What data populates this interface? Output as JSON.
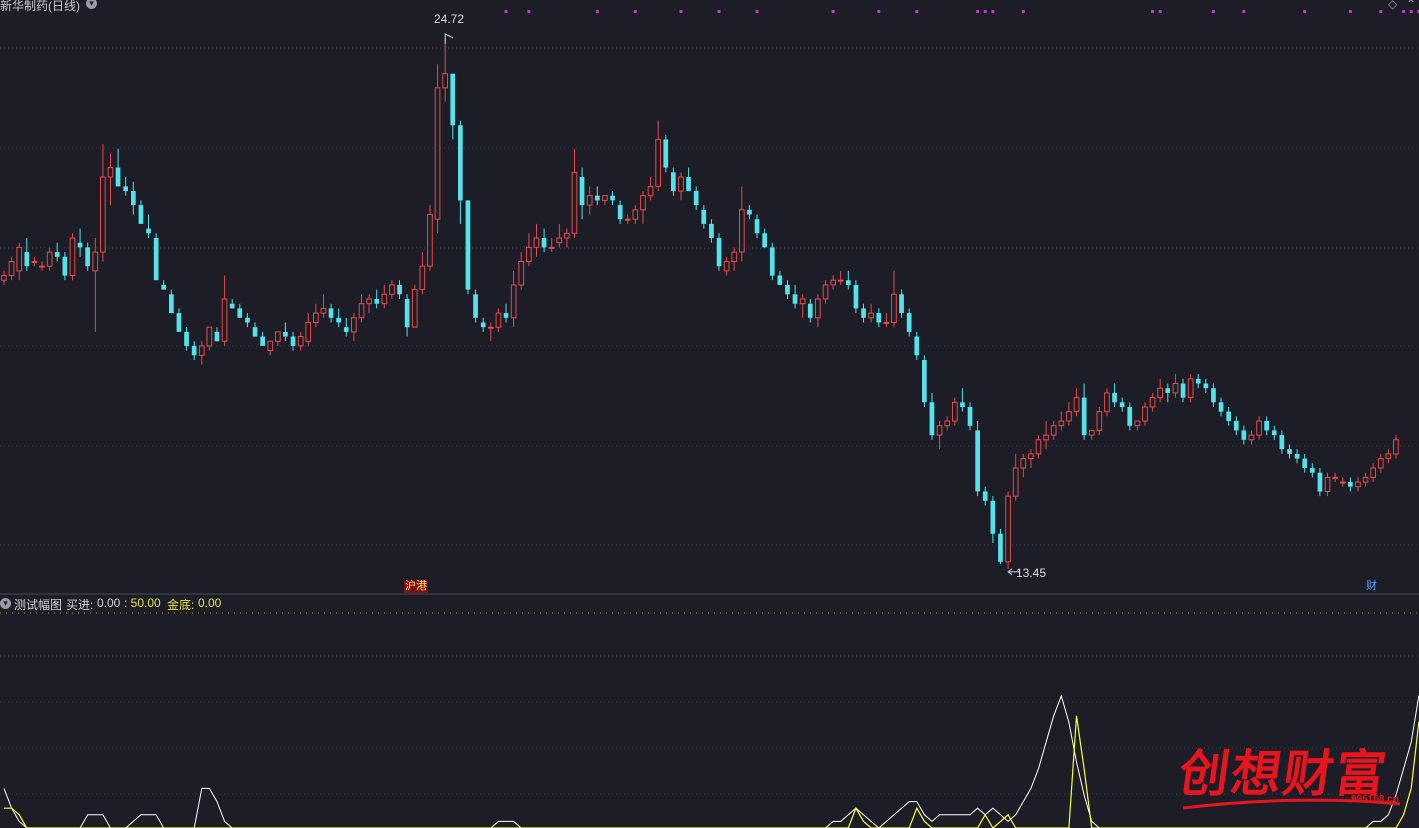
{
  "main_panel": {
    "title": "新华制药(日线)",
    "high_label": "24.72",
    "low_label": "13.45",
    "marker_hk": "沪港",
    "marker_cai": "财"
  },
  "indicator_panel": {
    "name": "测试幅图",
    "buy_label": "买进:",
    "buy_value": "0.00",
    "level_value": ": 50.00",
    "gold_label": "金底:",
    "gold_value": "0.00"
  },
  "watermark": {
    "text": "创想财富",
    "url": "995168.cn"
  },
  "colors": {
    "background": "#1c1d26",
    "up": "#e84a4a",
    "down": "#54e3ec",
    "grid": "#3b3d4c",
    "signal": "#cc33cc",
    "indicator_line": "#ffffff",
    "indicator_yellow": "#ffff33",
    "watermark": "#e8141e"
  },
  "chart_data": {
    "type": "candlestick",
    "y_range": [
      13.0,
      25.4
    ],
    "price_high": 24.72,
    "price_low": 13.45,
    "candles": [
      [
        19.6,
        19.8,
        19.5,
        19.7
      ],
      [
        19.7,
        20.1,
        19.6,
        20.0
      ],
      [
        19.8,
        20.4,
        19.6,
        20.3
      ],
      [
        20.2,
        20.5,
        19.8,
        19.9
      ],
      [
        20.0,
        20.1,
        19.9,
        20.0
      ],
      [
        19.9,
        20.0,
        19.8,
        19.9
      ],
      [
        19.9,
        20.3,
        19.8,
        20.2
      ],
      [
        20.2,
        20.4,
        20.0,
        20.1
      ],
      [
        20.1,
        20.2,
        19.6,
        19.7
      ],
      [
        19.7,
        20.6,
        19.6,
        20.5
      ],
      [
        20.4,
        20.7,
        20.1,
        20.3
      ],
      [
        20.3,
        20.4,
        19.8,
        19.9
      ],
      [
        19.8,
        20.5,
        18.5,
        20.2
      ],
      [
        20.2,
        22.5,
        20.0,
        21.8
      ],
      [
        21.8,
        22.3,
        21.2,
        22.0
      ],
      [
        22.0,
        22.4,
        21.6,
        21.6
      ],
      [
        21.6,
        21.8,
        21.4,
        21.5
      ],
      [
        21.5,
        21.7,
        21.0,
        21.2
      ],
      [
        21.2,
        21.3,
        20.8,
        20.8
      ],
      [
        20.7,
        21.0,
        20.5,
        20.6
      ],
      [
        20.5,
        20.6,
        19.6,
        19.6
      ],
      [
        19.5,
        19.6,
        19.4,
        19.4
      ],
      [
        19.3,
        19.4,
        18.9,
        18.9
      ],
      [
        18.9,
        19.0,
        18.5,
        18.5
      ],
      [
        18.5,
        18.6,
        18.1,
        18.2
      ],
      [
        18.2,
        18.3,
        17.9,
        18.0
      ],
      [
        18.0,
        18.3,
        17.8,
        18.2
      ],
      [
        18.2,
        18.6,
        18.1,
        18.6
      ],
      [
        18.5,
        18.6,
        18.3,
        18.3
      ],
      [
        18.3,
        19.7,
        18.2,
        19.2
      ],
      [
        19.1,
        19.2,
        19.0,
        19.0
      ],
      [
        19.0,
        19.1,
        18.8,
        18.8
      ],
      [
        18.8,
        18.9,
        18.6,
        18.7
      ],
      [
        18.6,
        18.7,
        18.4,
        18.4
      ],
      [
        18.4,
        18.5,
        18.2,
        18.2
      ],
      [
        18.1,
        18.3,
        18.0,
        18.3
      ],
      [
        18.3,
        18.5,
        18.2,
        18.5
      ],
      [
        18.5,
        18.7,
        18.3,
        18.4
      ],
      [
        18.4,
        18.5,
        18.1,
        18.2
      ],
      [
        18.2,
        18.5,
        18.1,
        18.4
      ],
      [
        18.3,
        18.9,
        18.2,
        18.7
      ],
      [
        18.7,
        19.1,
        18.6,
        18.9
      ],
      [
        18.9,
        19.3,
        18.8,
        19.0
      ],
      [
        19.0,
        19.1,
        18.7,
        18.8
      ],
      [
        18.8,
        19.0,
        18.6,
        18.7
      ],
      [
        18.6,
        18.8,
        18.4,
        18.5
      ],
      [
        18.5,
        18.9,
        18.3,
        18.8
      ],
      [
        18.8,
        19.3,
        18.7,
        19.1
      ],
      [
        19.1,
        19.3,
        18.9,
        19.2
      ],
      [
        19.2,
        19.4,
        19.0,
        19.1
      ],
      [
        19.1,
        19.5,
        19.0,
        19.3
      ],
      [
        19.3,
        19.6,
        19.2,
        19.5
      ],
      [
        19.5,
        19.6,
        19.2,
        19.3
      ],
      [
        19.2,
        19.3,
        18.4,
        18.6
      ],
      [
        18.6,
        19.5,
        18.6,
        19.4
      ],
      [
        19.4,
        20.2,
        19.3,
        19.9
      ],
      [
        19.9,
        21.2,
        19.8,
        21.0
      ],
      [
        20.9,
        24.2,
        20.6,
        23.7
      ],
      [
        23.7,
        24.72,
        23.4,
        24.0
      ],
      [
        24.0,
        24.0,
        22.6,
        22.9
      ],
      [
        22.9,
        23.0,
        20.8,
        21.3
      ],
      [
        21.3,
        21.3,
        19.3,
        19.4
      ],
      [
        19.3,
        19.4,
        18.7,
        18.8
      ],
      [
        18.7,
        18.8,
        18.5,
        18.6
      ],
      [
        18.6,
        18.7,
        18.3,
        18.6
      ],
      [
        18.6,
        19.0,
        18.5,
        18.9
      ],
      [
        18.9,
        19.1,
        18.7,
        18.8
      ],
      [
        18.8,
        19.8,
        18.6,
        19.5
      ],
      [
        19.5,
        20.2,
        19.4,
        20.0
      ],
      [
        20.0,
        20.6,
        19.9,
        20.3
      ],
      [
        20.3,
        20.8,
        20.1,
        20.5
      ],
      [
        20.5,
        20.7,
        20.2,
        20.3
      ],
      [
        20.3,
        20.5,
        20.2,
        20.3
      ],
      [
        20.4,
        20.8,
        20.3,
        20.5
      ],
      [
        20.5,
        20.7,
        20.3,
        20.6
      ],
      [
        20.6,
        22.4,
        20.5,
        21.9
      ],
      [
        21.8,
        22.0,
        20.9,
        21.2
      ],
      [
        21.2,
        21.6,
        21.0,
        21.4
      ],
      [
        21.4,
        21.6,
        21.2,
        21.3
      ],
      [
        21.3,
        21.4,
        21.2,
        21.4
      ],
      [
        21.4,
        21.5,
        21.2,
        21.3
      ],
      [
        21.2,
        21.3,
        20.8,
        20.9
      ],
      [
        20.9,
        21.0,
        20.8,
        20.9
      ],
      [
        20.9,
        21.2,
        20.8,
        21.1
      ],
      [
        21.1,
        21.5,
        20.8,
        21.4
      ],
      [
        21.4,
        21.8,
        21.3,
        21.6
      ],
      [
        21.6,
        23.0,
        21.5,
        22.6
      ],
      [
        22.6,
        22.7,
        21.9,
        22.0
      ],
      [
        21.9,
        22.0,
        21.4,
        21.5
      ],
      [
        21.5,
        21.9,
        21.3,
        21.8
      ],
      [
        21.8,
        22.0,
        21.5,
        21.5
      ],
      [
        21.5,
        21.6,
        21.1,
        21.2
      ],
      [
        21.1,
        21.2,
        20.7,
        20.8
      ],
      [
        20.8,
        20.9,
        20.4,
        20.5
      ],
      [
        20.5,
        20.6,
        19.8,
        19.9
      ],
      [
        19.8,
        20.1,
        19.7,
        20.0
      ],
      [
        20.0,
        20.3,
        19.8,
        20.2
      ],
      [
        20.2,
        21.6,
        20.0,
        21.1
      ],
      [
        21.1,
        21.2,
        20.9,
        21.0
      ],
      [
        20.9,
        21.0,
        20.5,
        20.6
      ],
      [
        20.6,
        20.7,
        20.3,
        20.3
      ],
      [
        20.3,
        20.4,
        19.6,
        19.7
      ],
      [
        19.7,
        19.8,
        19.5,
        19.5
      ],
      [
        19.5,
        19.6,
        19.2,
        19.3
      ],
      [
        19.3,
        19.5,
        19.0,
        19.1
      ],
      [
        19.1,
        19.3,
        18.8,
        19.2
      ],
      [
        19.1,
        19.2,
        18.7,
        18.8
      ],
      [
        18.8,
        19.3,
        18.6,
        19.2
      ],
      [
        19.2,
        19.6,
        19.1,
        19.5
      ],
      [
        19.5,
        19.7,
        19.4,
        19.6
      ],
      [
        19.6,
        19.8,
        19.5,
        19.6
      ],
      [
        19.6,
        19.8,
        19.4,
        19.5
      ],
      [
        19.5,
        19.6,
        18.9,
        19.0
      ],
      [
        19.0,
        19.1,
        18.7,
        18.8
      ],
      [
        18.8,
        19.1,
        18.7,
        18.9
      ],
      [
        18.9,
        19.0,
        18.6,
        18.7
      ],
      [
        18.7,
        18.9,
        18.6,
        18.7
      ],
      [
        18.7,
        19.8,
        18.6,
        19.3
      ],
      [
        19.3,
        19.4,
        18.8,
        18.9
      ],
      [
        18.9,
        19.0,
        18.4,
        18.5
      ],
      [
        18.4,
        18.5,
        17.9,
        18.0
      ],
      [
        17.9,
        18.0,
        16.9,
        17.0
      ],
      [
        17.0,
        17.2,
        16.2,
        16.3
      ],
      [
        16.3,
        16.6,
        16.0,
        16.5
      ],
      [
        16.5,
        16.7,
        16.4,
        16.6
      ],
      [
        16.6,
        17.1,
        16.5,
        17.0
      ],
      [
        17.0,
        17.3,
        16.8,
        16.9
      ],
      [
        16.9,
        17.0,
        16.4,
        16.5
      ],
      [
        16.4,
        16.6,
        15.0,
        15.1
      ],
      [
        15.1,
        15.2,
        14.8,
        14.9
      ],
      [
        14.9,
        15.0,
        14.0,
        14.2
      ],
      [
        14.2,
        14.3,
        13.55,
        13.6
      ],
      [
        13.6,
        15.1,
        13.45,
        15.0
      ],
      [
        15.0,
        15.9,
        14.9,
        15.6
      ],
      [
        15.6,
        15.9,
        15.4,
        15.8
      ],
      [
        15.8,
        16.0,
        15.6,
        15.9
      ],
      [
        15.9,
        16.3,
        15.8,
        16.2
      ],
      [
        16.2,
        16.6,
        16.0,
        16.3
      ],
      [
        16.3,
        16.6,
        16.2,
        16.5
      ],
      [
        16.5,
        16.8,
        16.4,
        16.6
      ],
      [
        16.6,
        17.0,
        16.5,
        16.8
      ],
      [
        16.8,
        17.3,
        16.7,
        17.1
      ],
      [
        17.1,
        17.4,
        16.2,
        16.3
      ],
      [
        16.3,
        16.4,
        16.2,
        16.4
      ],
      [
        16.4,
        16.9,
        16.3,
        16.8
      ],
      [
        16.8,
        17.3,
        16.7,
        17.2
      ],
      [
        17.2,
        17.4,
        16.9,
        17.0
      ],
      [
        17.0,
        17.1,
        16.8,
        16.9
      ],
      [
        16.9,
        17.0,
        16.4,
        16.5
      ],
      [
        16.5,
        16.6,
        16.4,
        16.6
      ],
      [
        16.6,
        17.0,
        16.5,
        16.9
      ],
      [
        16.9,
        17.2,
        16.8,
        17.1
      ],
      [
        17.1,
        17.5,
        17.0,
        17.3
      ],
      [
        17.3,
        17.4,
        17.0,
        17.2
      ],
      [
        17.2,
        17.6,
        17.1,
        17.4
      ],
      [
        17.4,
        17.5,
        17.0,
        17.1
      ],
      [
        17.1,
        17.6,
        17.0,
        17.5
      ],
      [
        17.5,
        17.6,
        17.3,
        17.4
      ],
      [
        17.4,
        17.5,
        17.2,
        17.3
      ],
      [
        17.3,
        17.4,
        16.9,
        17.0
      ],
      [
        17.0,
        17.1,
        16.7,
        16.8
      ],
      [
        16.8,
        16.9,
        16.5,
        16.6
      ],
      [
        16.6,
        16.7,
        16.3,
        16.4
      ],
      [
        16.4,
        16.5,
        16.1,
        16.2
      ],
      [
        16.2,
        16.4,
        16.1,
        16.3
      ],
      [
        16.3,
        16.7,
        16.2,
        16.6
      ],
      [
        16.6,
        16.7,
        16.3,
        16.4
      ],
      [
        16.4,
        16.5,
        16.2,
        16.3
      ],
      [
        16.3,
        16.4,
        15.9,
        16.0
      ],
      [
        16.0,
        16.1,
        15.8,
        15.9
      ],
      [
        15.9,
        16.0,
        15.7,
        15.8
      ],
      [
        15.8,
        15.9,
        15.5,
        15.6
      ],
      [
        15.6,
        15.7,
        15.4,
        15.5
      ],
      [
        15.5,
        15.6,
        15.0,
        15.1
      ],
      [
        15.1,
        15.5,
        15.0,
        15.4
      ],
      [
        15.4,
        15.5,
        15.3,
        15.4
      ],
      [
        15.3,
        15.4,
        15.2,
        15.3
      ],
      [
        15.3,
        15.4,
        15.1,
        15.2
      ],
      [
        15.2,
        15.4,
        15.1,
        15.3
      ],
      [
        15.3,
        15.5,
        15.2,
        15.4
      ],
      [
        15.4,
        15.7,
        15.3,
        15.6
      ],
      [
        15.6,
        15.9,
        15.5,
        15.8
      ],
      [
        15.8,
        16.0,
        15.7,
        15.9
      ],
      [
        15.9,
        16.3,
        15.8,
        16.2
      ]
    ],
    "signal_markers": [
      66,
      69,
      78,
      83,
      89,
      94,
      99,
      109,
      115,
      120,
      128,
      129,
      130,
      134,
      151,
      152,
      159,
      163,
      171,
      177,
      181,
      184,
      185,
      186,
      194,
      195,
      200
    ],
    "indicator": {
      "white": [
        6,
        3,
        1,
        0,
        0,
        0,
        0,
        0,
        0,
        0,
        0,
        2,
        2,
        2,
        0,
        0,
        0,
        1,
        2,
        2,
        2,
        0,
        0,
        0,
        0,
        0,
        6,
        6,
        4,
        1,
        0,
        0,
        0,
        0,
        0,
        0,
        0,
        0,
        0,
        0,
        0,
        0,
        0,
        0,
        0,
        0,
        0,
        0,
        0,
        0,
        0,
        0,
        0,
        0,
        0,
        0,
        0,
        0,
        0,
        0,
        0,
        0,
        0,
        0,
        0,
        1,
        1,
        1,
        0,
        0,
        0,
        0,
        0,
        0,
        0,
        0,
        0,
        0,
        0,
        0,
        0,
        0,
        0,
        0,
        0,
        0,
        0,
        0,
        0,
        0,
        0,
        0,
        0,
        0,
        0,
        0,
        0,
        0,
        0,
        0,
        0,
        0,
        0,
        0,
        0,
        0,
        0,
        0,
        0,
        1,
        1,
        2,
        3,
        2,
        1,
        0,
        1,
        2,
        3,
        4,
        4,
        2,
        1,
        2,
        2,
        2,
        2,
        2,
        3,
        2,
        3,
        2,
        1,
        2,
        4,
        6,
        9,
        13,
        17,
        20,
        16,
        10,
        5,
        1,
        0,
        0,
        0,
        0,
        0,
        0,
        0,
        0,
        0,
        0,
        0,
        0,
        0,
        0,
        0,
        0,
        0,
        0,
        0,
        0,
        0,
        0,
        0,
        0,
        0,
        0,
        0,
        0,
        0,
        0,
        0,
        0,
        0,
        0,
        0,
        0,
        1,
        1,
        2,
        5,
        9,
        13,
        20,
        21,
        18,
        10,
        5,
        2,
        0,
        0,
        0,
        0,
        0,
        0,
        0,
        0,
        0,
        0,
        0,
        0,
        0
      ],
      "yellow": [
        3,
        3,
        2,
        0,
        0,
        0,
        0,
        0,
        0,
        0,
        0,
        0,
        0,
        0,
        0,
        0,
        0,
        0,
        0,
        0,
        0,
        0,
        0,
        0,
        0,
        0,
        0,
        0,
        0,
        0,
        0,
        0,
        0,
        0,
        0,
        0,
        0,
        0,
        0,
        0,
        0,
        0,
        0,
        0,
        0,
        0,
        0,
        0,
        0,
        0,
        0,
        0,
        0,
        0,
        0,
        0,
        0,
        0,
        0,
        0,
        0,
        0,
        0,
        0,
        0,
        0,
        0,
        0,
        0,
        0,
        0,
        0,
        0,
        0,
        0,
        0,
        0,
        0,
        0,
        0,
        0,
        0,
        0,
        0,
        0,
        0,
        0,
        0,
        0,
        0,
        0,
        0,
        0,
        0,
        0,
        0,
        0,
        0,
        0,
        0,
        0,
        0,
        0,
        0,
        0,
        0,
        0,
        0,
        0,
        0,
        0,
        0,
        3,
        1,
        0,
        0,
        0,
        0,
        0,
        0,
        3,
        1,
        0,
        0,
        0,
        0,
        0,
        0,
        0,
        2,
        0,
        1,
        2,
        0,
        0,
        0,
        0,
        0,
        0,
        0,
        0,
        17,
        9,
        0,
        0,
        0,
        0,
        0,
        0,
        0,
        0,
        0,
        0,
        0,
        0,
        0,
        0,
        0,
        0,
        0,
        0,
        0,
        0,
        0,
        0,
        0,
        0,
        0,
        0,
        0,
        0,
        0,
        0,
        0,
        0,
        0,
        0,
        0,
        0,
        0,
        0,
        0,
        0,
        0,
        2,
        6,
        16,
        18,
        10,
        2,
        0,
        0,
        0,
        0,
        0,
        0,
        0,
        0,
        0,
        0,
        0,
        0,
        0,
        0,
        0
      ]
    }
  }
}
